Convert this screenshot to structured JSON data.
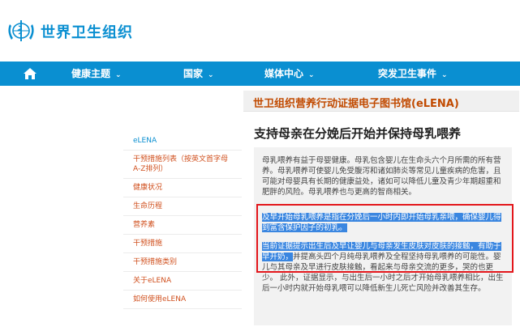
{
  "header": {
    "org_name": "世界卫生组织"
  },
  "nav": {
    "items": [
      {
        "label": "健康主题"
      },
      {
        "label": "国家"
      },
      {
        "label": "媒体中心"
      },
      {
        "label": "突发卫生事件"
      }
    ],
    "caret": "⌄"
  },
  "library": {
    "title": "世卫组织营养行动证据电子图书馆(eLENA)"
  },
  "sidebar": {
    "items": [
      {
        "label": "eLENA"
      },
      {
        "label": "干预措施列表（按英文首字母A-Z排列）"
      },
      {
        "label": "健康状况"
      },
      {
        "label": "生命历程"
      },
      {
        "label": "营养素"
      },
      {
        "label": "干预措施"
      },
      {
        "label": "干预措施类别"
      },
      {
        "label": "关于eLENA"
      },
      {
        "label": "如何使用eLENA"
      }
    ]
  },
  "main": {
    "title": "支持母亲在分娩后开始并保持母乳喂养",
    "para1": "母乳喂养有益于母婴健康。母乳包含婴儿在生命头六个月所需的所有营养。母乳喂养可使婴儿免受腹泻和诸如肺炎等常见儿童疾病的危害，且可能对母婴具有长期的健康益处，诸如可以降低儿童及青少年期超重和肥胖的风险。母乳喂养也与更高的智商相关。",
    "para2_hl": "及早开始母乳喂养是指在分娩后一小时内即开始母乳亲喂，确保婴儿得到富含保护因子的初乳。",
    "para3_hl": "当前证据提示出生后及早让婴儿与母亲发生皮肤对皮肤的接触，有助于早开奶，",
    "para3_rest": "并提高头四个月纯母乳喂养及全程坚持母乳喂养的可能性。婴儿与其母亲及早进行皮肤接触，看起来与母亲交流的更多，哭的也更少。 此外，证据显示，与出生后一小时之后才开始母乳喂养相比，出生后一小时内就开始母乳喂可以降低新生儿死亡风险并改善其生存。"
  },
  "colors": {
    "brand_blue": "#0a8fd1",
    "link_orange": "#d0501e",
    "highlight": "#3a86e0",
    "annotation_red": "#e3161b"
  }
}
